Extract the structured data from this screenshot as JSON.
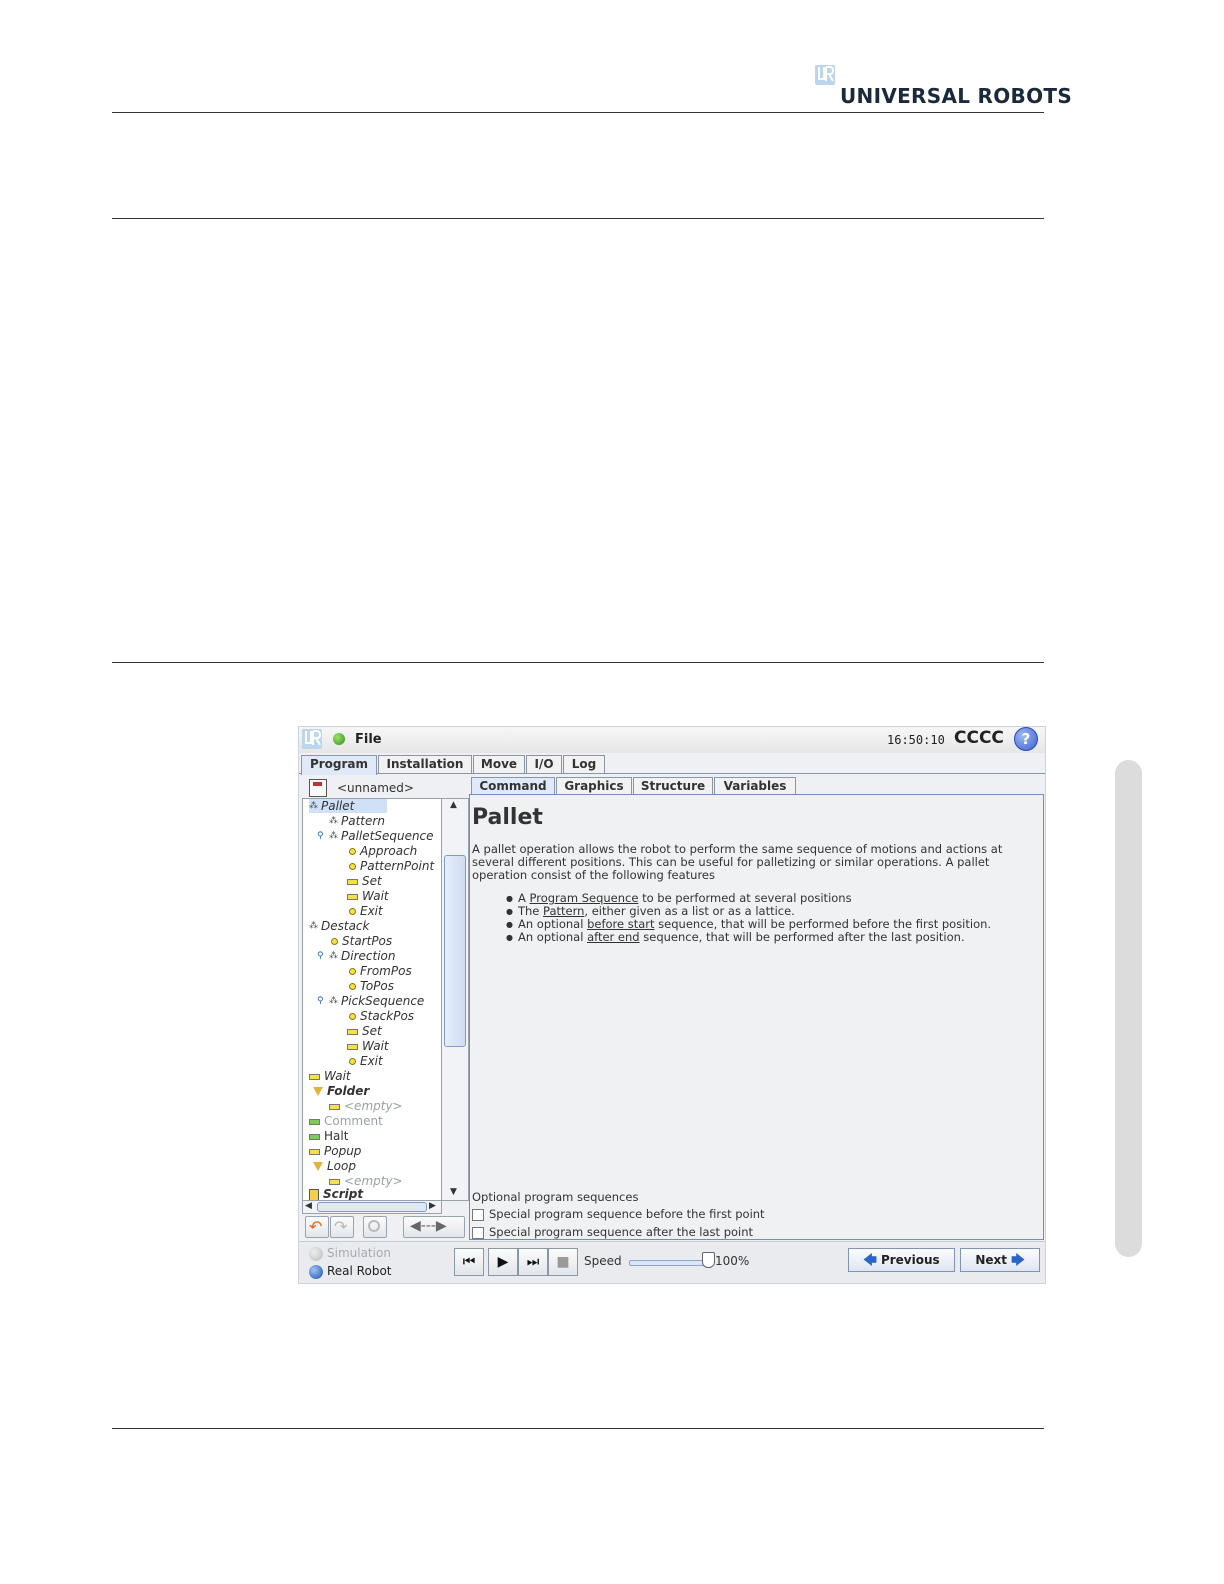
{
  "header": {
    "brand": "UNIVERSAL ROBOTS"
  },
  "app": {
    "menu_file": "File",
    "clock": "16:50:10",
    "robot_name": "CCCC",
    "help_glyph": "?",
    "main_tabs": [
      {
        "label": "Program",
        "active": true
      },
      {
        "label": "Installation",
        "active": false
      },
      {
        "label": "Move",
        "active": false
      },
      {
        "label": "I/O",
        "active": false
      },
      {
        "label": "Log",
        "active": false
      }
    ],
    "program_name": "<unnamed>",
    "tree": [
      {
        "label": "Pallet",
        "icon": "pallet-icon"
      },
      {
        "label": "Pattern",
        "icon": "pattern-icon"
      },
      {
        "label": "PalletSequence",
        "icon": "sequence-icon"
      },
      {
        "label": "Approach",
        "icon": "waypoint-icon"
      },
      {
        "label": "PatternPoint",
        "icon": "waypoint-icon"
      },
      {
        "label": "Set",
        "icon": "set-icon"
      },
      {
        "label": "Wait",
        "icon": "wait-icon"
      },
      {
        "label": "Exit",
        "icon": "waypoint-icon"
      },
      {
        "label": "Destack",
        "icon": "destack-icon"
      },
      {
        "label": "StartPos",
        "icon": "waypoint-icon"
      },
      {
        "label": "Direction",
        "icon": "direction-icon"
      },
      {
        "label": "FromPos",
        "icon": "waypoint-icon"
      },
      {
        "label": "ToPos",
        "icon": "waypoint-icon"
      },
      {
        "label": "PickSequence",
        "icon": "sequence-icon"
      },
      {
        "label": "StackPos",
        "icon": "waypoint-icon"
      },
      {
        "label": "Set",
        "icon": "set-icon"
      },
      {
        "label": "Wait",
        "icon": "wait-icon"
      },
      {
        "label": "Exit",
        "icon": "waypoint-icon"
      },
      {
        "label": "Wait",
        "icon": "wait-icon"
      },
      {
        "label": "Folder",
        "icon": "folder-icon"
      },
      {
        "label": "<empty>",
        "icon": "empty-icon"
      },
      {
        "label": "Comment",
        "icon": "comment-icon"
      },
      {
        "label": "Halt",
        "icon": "halt-icon"
      },
      {
        "label": "Popup",
        "icon": "popup-icon"
      },
      {
        "label": "Loop",
        "icon": "loop-icon"
      },
      {
        "label": "<empty>",
        "icon": "empty-icon"
      },
      {
        "label": "Script",
        "icon": "script-icon"
      }
    ],
    "sub_tabs": [
      {
        "label": "Command",
        "active": true
      },
      {
        "label": "Graphics",
        "active": false
      },
      {
        "label": "Structure",
        "active": false
      },
      {
        "label": "Variables",
        "active": false
      }
    ],
    "command": {
      "title": "Pallet",
      "description": "A pallet operation allows the robot to perform the same sequence of motions and actions at several different positions. This can be useful for palletizing or similar operations. A pallet operation consist of the following features",
      "bullets": [
        {
          "pre": "A ",
          "link": "Program Sequence",
          "post": " to be performed at several positions"
        },
        {
          "pre": "The ",
          "link": "Pattern",
          "post": ", either given as a list or as a lattice."
        },
        {
          "pre": "An optional ",
          "link": "before start",
          "post": " sequence, that will be performed before the first position."
        },
        {
          "pre": "An optional ",
          "link": "after end",
          "post": " sequence, that will be performed after the last position."
        }
      ],
      "optional_title": "Optional program sequences",
      "opt_before": "Special program sequence before the first point",
      "opt_after": "Special program sequence after the last point"
    },
    "bottom": {
      "simulation": "Simulation",
      "real_robot": "Real Robot",
      "speed_label": "Speed",
      "speed_value": "100%",
      "speed_fraction": 1.0,
      "previous": "Previous",
      "next": "Next"
    },
    "colors": {
      "accent": "#2a64c8",
      "status_green": "#2f8f1a"
    }
  }
}
